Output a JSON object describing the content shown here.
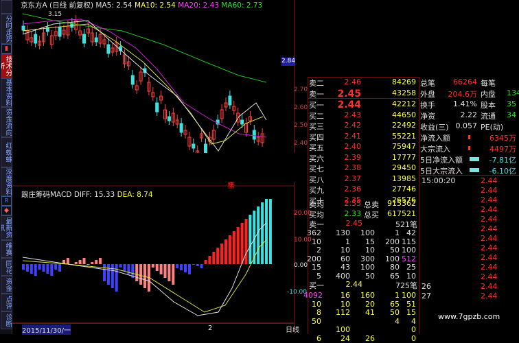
{
  "header": {
    "stock_name": "京东方A",
    "period": "(日线 前复权)",
    "ma5": "MA5: 2.54",
    "ma10": "MA10: 2.54",
    "ma20": "MA20: 2.43",
    "ma60": "MA60: 2.73",
    "high_label": "3.15",
    "price_tag": "2.84",
    "rise_marker": "涨"
  },
  "tabs": [
    "分时走势",
    "技术分析",
    "基本资料",
    "资金流向",
    "红蜘蛛",
    "深度资料",
    "最新资讯",
    "维赛",
    "同花",
    "资金",
    "点评",
    "诊断"
  ],
  "price_axis": [
    "2.70",
    "2.60",
    "2.50",
    "2.40"
  ],
  "macd": {
    "title": "跟庄筹码MACD",
    "diff": "DIFF: 15.33",
    "dea": "DEA: 8.74",
    "axis": [
      "20.00",
      "10.00",
      "0.00",
      "-10.00"
    ]
  },
  "bottom_bar": {
    "date": "2015/11/30/一",
    "mark": "2",
    "period_label": "日线"
  },
  "order_book": {
    "asks": [
      {
        "label": "卖二",
        "price": "2.46",
        "vol": "84269"
      },
      {
        "label": "卖一",
        "price": "2.45",
        "vol": "43258"
      }
    ],
    "bids": [
      {
        "label": "买一",
        "price": "2.44",
        "vol": "42212"
      },
      {
        "label": "买二",
        "price": "2.43",
        "vol": "44650"
      },
      {
        "label": "买三",
        "price": "2.42",
        "vol": "22492"
      },
      {
        "label": "买四",
        "price": "2.41",
        "vol": "55221"
      },
      {
        "label": "买五",
        "price": "2.40",
        "vol": "75947"
      },
      {
        "label": "买六",
        "price": "2.39",
        "vol": "17777"
      },
      {
        "label": "买七",
        "price": "2.38",
        "vol": "29450"
      },
      {
        "label": "买八",
        "price": "2.37",
        "vol": "13985"
      },
      {
        "label": "买九",
        "price": "2.36",
        "vol": "27746"
      },
      {
        "label": "买十",
        "price": "2.35",
        "vol": "26576"
      }
    ],
    "avg_ask_label": "卖均",
    "avg_ask": "2.55",
    "total_ask_label": "总卖",
    "total_ask": "915362",
    "avg_bid_label": "买均",
    "avg_bid": "2.33",
    "total_bid_label": "总买",
    "total_bid": "617521"
  },
  "stats": [
    {
      "k": "总笔",
      "v": "66264",
      "k2": "每笔"
    },
    {
      "k": "外盘",
      "v": "204.6万",
      "k2": "内盘",
      "v2": "134"
    },
    {
      "k": "换手",
      "v": "1.41%",
      "k2": "股本",
      "v2": "35"
    },
    {
      "k": "净资",
      "v": "2.22",
      "k2": "流通",
      "v2": "34"
    },
    {
      "k": "收益(三)",
      "v": "0.057",
      "k2": "PE(动)"
    }
  ],
  "flow": [
    {
      "k": "净流入额",
      "v": "6345万"
    },
    {
      "k": "大宗流入",
      "v": "4497万"
    },
    {
      "k": "5日净流入额",
      "v": "-7.81亿"
    },
    {
      "k": "5日大宗流入",
      "v": "-6.10亿"
    }
  ],
  "queue_sell": {
    "label": "卖一",
    "price": "2.45",
    "count": "521笔",
    "rows": [
      [
        "362",
        "130",
        "100",
        "1",
        "42"
      ],
      [
        "10",
        "1",
        "15",
        "200",
        "115"
      ],
      [
        "2",
        "10",
        "10",
        "50",
        "100"
      ],
      [
        "200",
        "60",
        "300",
        "100",
        "512"
      ],
      [
        "15",
        "43",
        "100",
        "80",
        "25"
      ],
      [
        "5",
        "400",
        "50",
        "65",
        "10"
      ]
    ]
  },
  "queue_buy": {
    "label": "买一",
    "price": "2.44",
    "count": "725笔",
    "rows": [
      [
        "4092",
        "16",
        "160",
        "1",
        "100"
      ],
      [
        "10",
        "10",
        "20",
        "65",
        "51"
      ],
      [
        "8",
        "112",
        "41",
        "50",
        "15"
      ],
      [
        "50",
        "",
        "",
        "4",
        "4"
      ],
      [
        "",
        "100",
        "",
        "",
        "0"
      ],
      [
        "6",
        "24",
        "26",
        "",
        "0"
      ]
    ]
  },
  "ticks": [
    {
      "t": "15:00:20",
      "p": "2.44"
    },
    {
      "t": "",
      "p": "2.44"
    },
    {
      "t": "",
      "p": "2.44"
    },
    {
      "t": "",
      "p": "2.44"
    },
    {
      "t": "",
      "p": "2.44"
    },
    {
      "t": "",
      "p": "2.44"
    },
    {
      "t": "",
      "p": "2.44"
    },
    {
      "t": "",
      "p": "2.44"
    },
    {
      "t": "",
      "p": "2.44"
    },
    {
      "t": "",
      "p": "2.44"
    },
    {
      "t": "",
      "p": "2.44"
    },
    {
      "t": "26",
      "p": "2.44"
    },
    {
      "t": "27",
      "p": "2.44"
    }
  ],
  "watermark": "www.7gpzb.com"
}
